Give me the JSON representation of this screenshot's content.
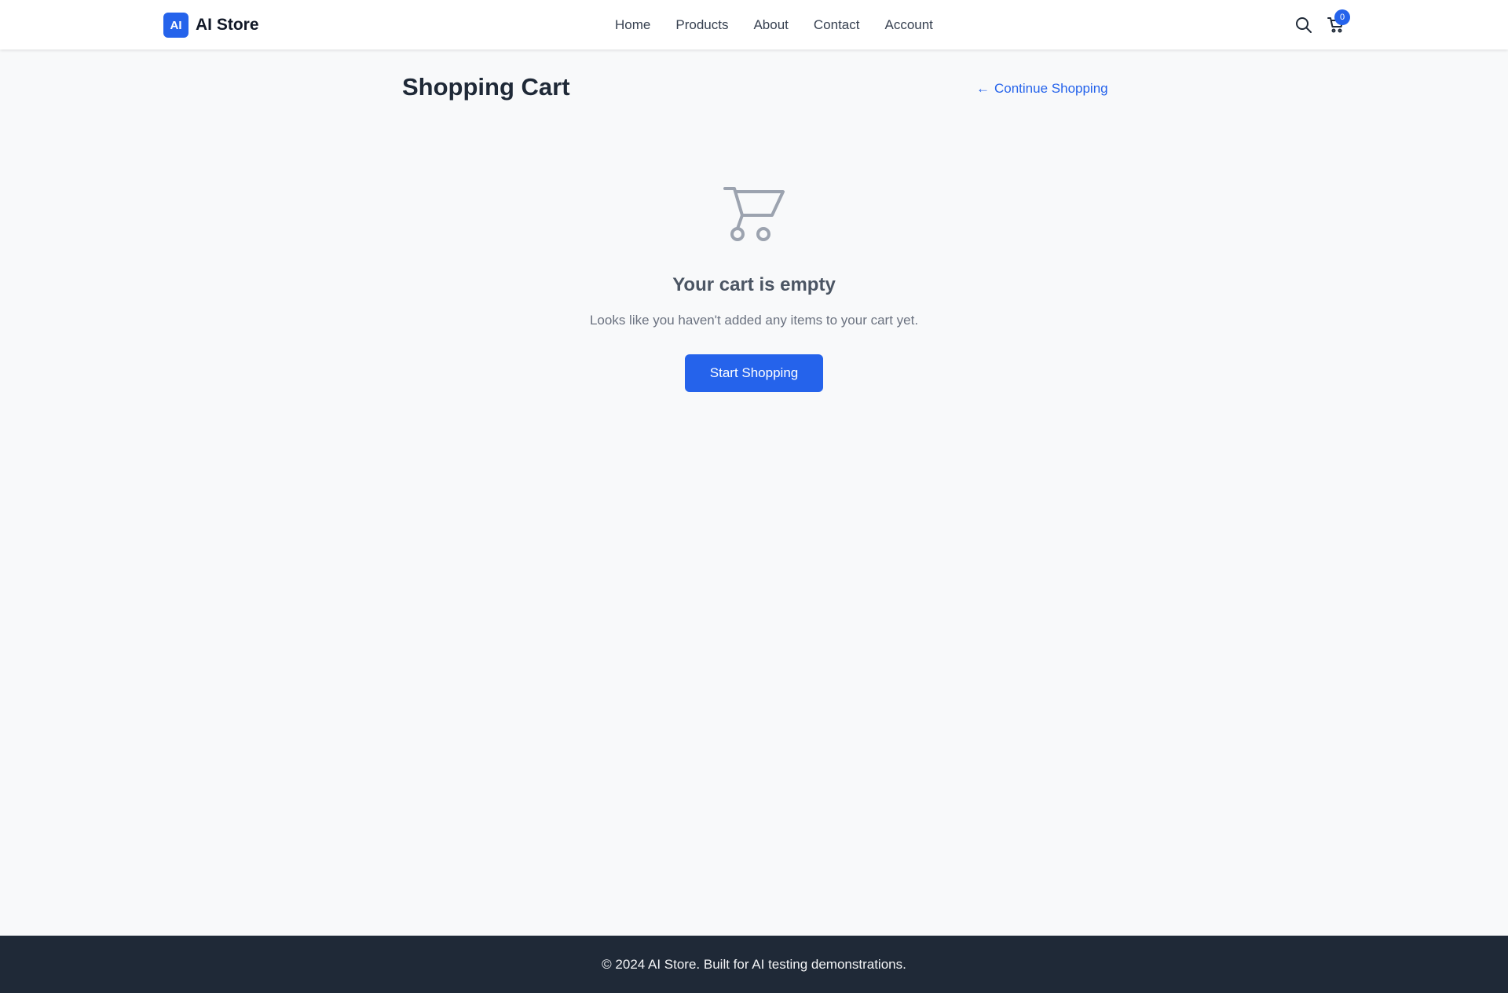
{
  "brand": {
    "badge": "AI",
    "name": "AI Store",
    "accent": "#2563eb"
  },
  "nav": {
    "links": [
      "Home",
      "Products",
      "About",
      "Contact",
      "Account"
    ]
  },
  "header_icons": {
    "search": "search-icon",
    "cart": "cart-icon",
    "cart_count": "0"
  },
  "page": {
    "title": "Shopping Cart",
    "continue_label": "Continue Shopping",
    "continue_icon": "arrow-left-icon"
  },
  "empty_state": {
    "icon": "cart-icon",
    "title": "Your cart is empty",
    "message": "Looks like you haven't added any items to your cart yet.",
    "button_label": "Start Shopping"
  },
  "footer": {
    "text": "© 2024 AI Store. Built for AI testing demonstrations."
  }
}
